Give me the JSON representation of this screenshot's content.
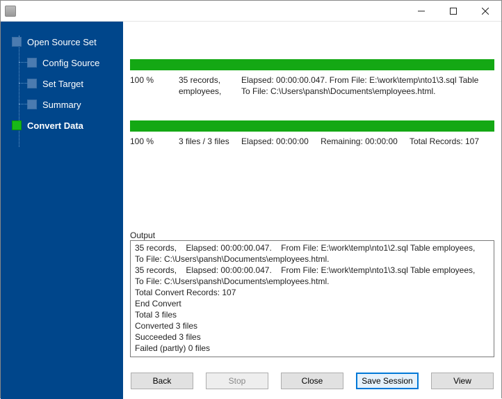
{
  "window": {
    "title": ""
  },
  "sidebar": {
    "items": [
      {
        "label": "Open Source Set"
      },
      {
        "label": "Config Source"
      },
      {
        "label": "Set Target"
      },
      {
        "label": "Summary"
      },
      {
        "label": "Convert Data"
      }
    ]
  },
  "progress1": {
    "percent": "100 %",
    "records_line1": "35 records,",
    "records_line2": "employees,",
    "detail_line1": "Elapsed: 00:00:00.047.    From File: E:\\work\\temp\\nto1\\3.sql Table",
    "detail_line2": "To File: C:\\Users\\pansh\\Documents\\employees.html."
  },
  "progress2": {
    "percent": "100 %",
    "files": "3 files / 3 files",
    "elapsed": "Elapsed: 00:00:00",
    "remaining": "Remaining: 00:00:00",
    "total": "Total Records: 107"
  },
  "output": {
    "label": "Output",
    "lines": [
      "35 records,    Elapsed: 00:00:00.047.    From File: E:\\work\\temp\\nto1\\2.sql Table employees,    To File: C:\\Users\\pansh\\Documents\\employees.html.",
      "35 records,    Elapsed: 00:00:00.047.    From File: E:\\work\\temp\\nto1\\3.sql Table employees,    To File: C:\\Users\\pansh\\Documents\\employees.html.",
      "Total Convert Records: 107",
      "End Convert",
      "Total 3 files",
      "Converted 3 files",
      "Succeeded 3 files",
      "Failed (partly) 0 files"
    ]
  },
  "buttons": {
    "back": "Back",
    "stop": "Stop",
    "close": "Close",
    "save": "Save Session",
    "view": "View"
  }
}
